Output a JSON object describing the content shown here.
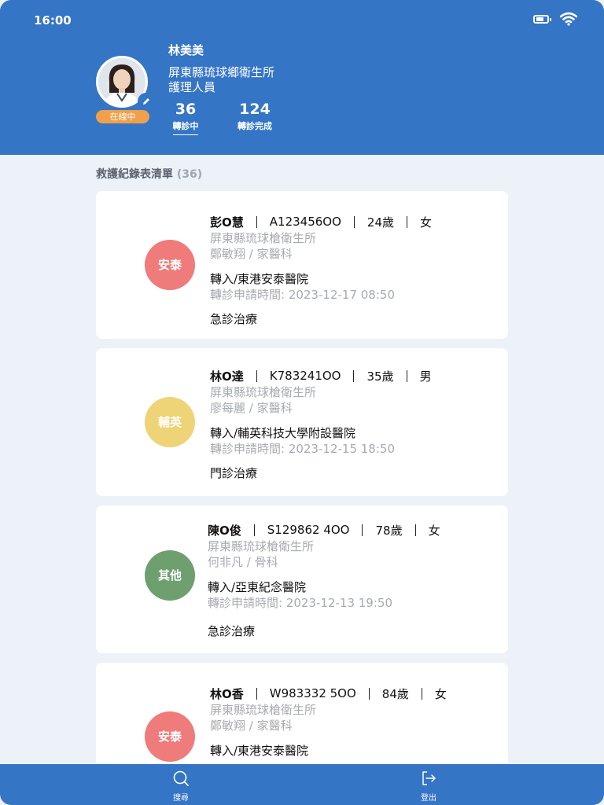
{
  "status_bar": {
    "time": "16:00"
  },
  "profile": {
    "name": "林美美",
    "org": "屏東縣琉球鄉衛生所",
    "role": "護理人員",
    "online_label": "在線中",
    "stats": [
      {
        "value": "36",
        "label": "轉診中"
      },
      {
        "value": "124",
        "label": "轉診完成"
      }
    ]
  },
  "list": {
    "title": "救護紀錄表清單",
    "count": "(36)"
  },
  "cards": [
    {
      "tag": "安泰",
      "tag_color": "#ef7b7b",
      "name": "彭O慧",
      "id": "A123456OO",
      "age": "24歲",
      "gender": "女",
      "clinic": "屏東縣琉球槍衛生所",
      "doctor": "鄭敏翔 / 家醫科",
      "transfer": "轉入/東港安泰醫院",
      "time": "轉診申請時間: 2023-12-17  08:50",
      "treatment": "急診治療"
    },
    {
      "tag": "輔英",
      "tag_color": "#efd377",
      "name": "林O達",
      "id": "K783241OO",
      "age": "35歲",
      "gender": "男",
      "clinic": "屏東縣琉球槍衛生所",
      "doctor": "廖每麗 / 家醫科",
      "transfer": "轉入/輔英科技大學附設醫院",
      "time": "轉診申請時間: 2023-12-15  18:50",
      "treatment": "門診治療"
    },
    {
      "tag": "其他",
      "tag_color": "#6e9f6e",
      "name": "陳O俊",
      "id": "S129862 4OO",
      "age": "78歲",
      "gender": "女",
      "clinic": "屏東縣琉球槍衛生所",
      "doctor": "何非凡 / 骨科",
      "transfer": "轉入/亞東紀念醫院",
      "time": "轉診申請時間: 2023-12-13  19:50",
      "treatment": "急診治療"
    },
    {
      "tag": "安泰",
      "tag_color": "#ef7b7b",
      "name": "林O香",
      "id": "W983332 5OO",
      "age": "84歲",
      "gender": "女",
      "clinic": "屏東縣琉球槍衛生所",
      "doctor": "鄭敏翔 / 家醫科",
      "transfer": "轉入/東港安泰醫院",
      "time": "",
      "treatment": ""
    }
  ],
  "nav": {
    "search_label": "搜尋",
    "logout_label": "登出"
  },
  "colors": {
    "primary": "#3575c5",
    "background": "#edf2f9",
    "online": "#f0a04a"
  }
}
